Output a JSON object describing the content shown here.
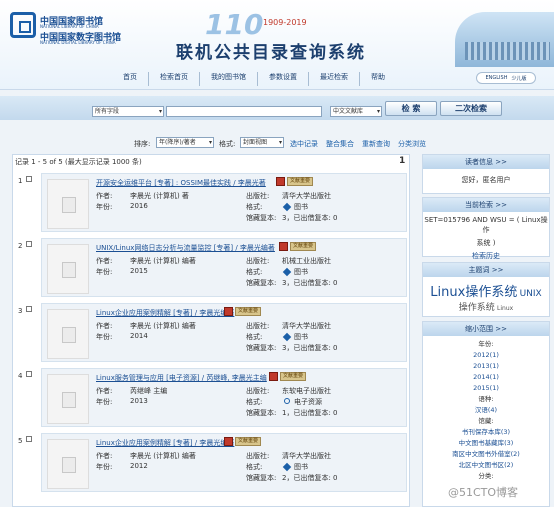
{
  "header": {
    "lib1_cn": "中国国家图书馆",
    "lib1_en": "NATIONAL LIBRARY OF CHINA",
    "lib2_cn": "中国国家数字图书馆",
    "lib2_en": "NATIONAL DIGITAL LIBRARY OF CHINA",
    "anniv_num": "110",
    "anniv_years": "1909-2019",
    "system_title": "联机公共目录查询系统",
    "nav": [
      "首页",
      "检索首页",
      "我的图书馆",
      "参数设置",
      "最近检索",
      "帮助"
    ],
    "lang": [
      "ENGLISH",
      "少儿版"
    ]
  },
  "search": {
    "field": "所有字段",
    "query": "",
    "database": "中文文献库",
    "search_btn": "检 索",
    "second_btn": "二次检索"
  },
  "sortbar": {
    "sort_label": "排序:",
    "sort_value": "年(降序)/著者",
    "format_label": "格式:",
    "format_value": "封面视图",
    "links": [
      "选中记录",
      "整合集合",
      "重新查询",
      "分类浏览"
    ]
  },
  "results": {
    "header": "记录 1 - 5 of 5 (最大显示记录 1000 条)",
    "page": "1",
    "labels": {
      "author": "作者:",
      "year": "年份:",
      "publisher": "出版社:",
      "format": "格式:",
      "holdings": "馆藏复本:"
    },
    "badge": "文献重要",
    "records": [
      {
        "index": "1",
        "title": "开源安全运维平台 [专著] : OSSIM最佳实践 / 李晨光著",
        "author": "李晨光 (计算机) 著",
        "year": "2016",
        "publisher": "清华大学出版社",
        "format": "图书",
        "holdings": "3，已出借复本: 0"
      },
      {
        "index": "2",
        "title": "UNIX/Linux网络日志分析与流量监控 [专著] / 李晨光编著",
        "author": "李晨光 (计算机) 编著",
        "year": "2015",
        "publisher": "机械工业出版社",
        "format": "图书",
        "holdings": "3，已出借复本: 0"
      },
      {
        "index": "3",
        "title": "Linux企业应用案例精解 [专著] / 李晨光编著",
        "author": "李晨光 (计算机) 编著",
        "year": "2014",
        "publisher": "清华大学出版社",
        "format": "图书",
        "holdings": "3，已出借复本: 0"
      },
      {
        "index": "4",
        "title": "Linux服务管理与应用 [电子资源] / 芮继峰, 李晨光主编",
        "author": "芮继峰 主编",
        "year": "2013",
        "publisher": "东软电子出版社",
        "format": "电子资源",
        "holdings": "1，已出借复本: 0"
      },
      {
        "index": "5",
        "title": "Linux企业应用案例精解 [专著] / 李晨光编著",
        "author": "李晨光 (计算机) 编著",
        "year": "2012",
        "publisher": "清华大学出版社",
        "format": "图书",
        "holdings": "2，已出借复本: 0"
      }
    ]
  },
  "sidebar": {
    "reader_title": "读者信息 >>",
    "reader_text": "您好，匿名用户",
    "query_title": "当前检索 >>",
    "query_text1": "SET=015796 AND WSU = ( Linux操作",
    "query_text2": "系统 )",
    "history": "检索历史",
    "topic_title": "主题词 >>",
    "topics": [
      "Linux操作系统",
      "UNIX",
      "操作系统",
      "Linux"
    ],
    "facet_title": "缩小范围 >>",
    "facets": [
      {
        "head": true,
        "text": "年份:"
      },
      {
        "text": "2012(1)"
      },
      {
        "text": "2013(1)"
      },
      {
        "text": "2014(1)"
      },
      {
        "text": "2015(1)"
      },
      {
        "head": true,
        "text": "语种:"
      },
      {
        "text": "汉语(4)"
      },
      {
        "head": true,
        "text": "馆藏:"
      },
      {
        "text": "书刊保存本库(3)"
      },
      {
        "text": "中文图书基藏库(3)"
      },
      {
        "text": "南区中文图书外借室(2)"
      },
      {
        "text": "北区中文图书区(2)"
      },
      {
        "text": "分类:"
      }
    ]
  },
  "watermark": "@51CTO博客",
  "colors": {
    "accent": "#1b5fa8",
    "panel": "#eef3f8"
  }
}
